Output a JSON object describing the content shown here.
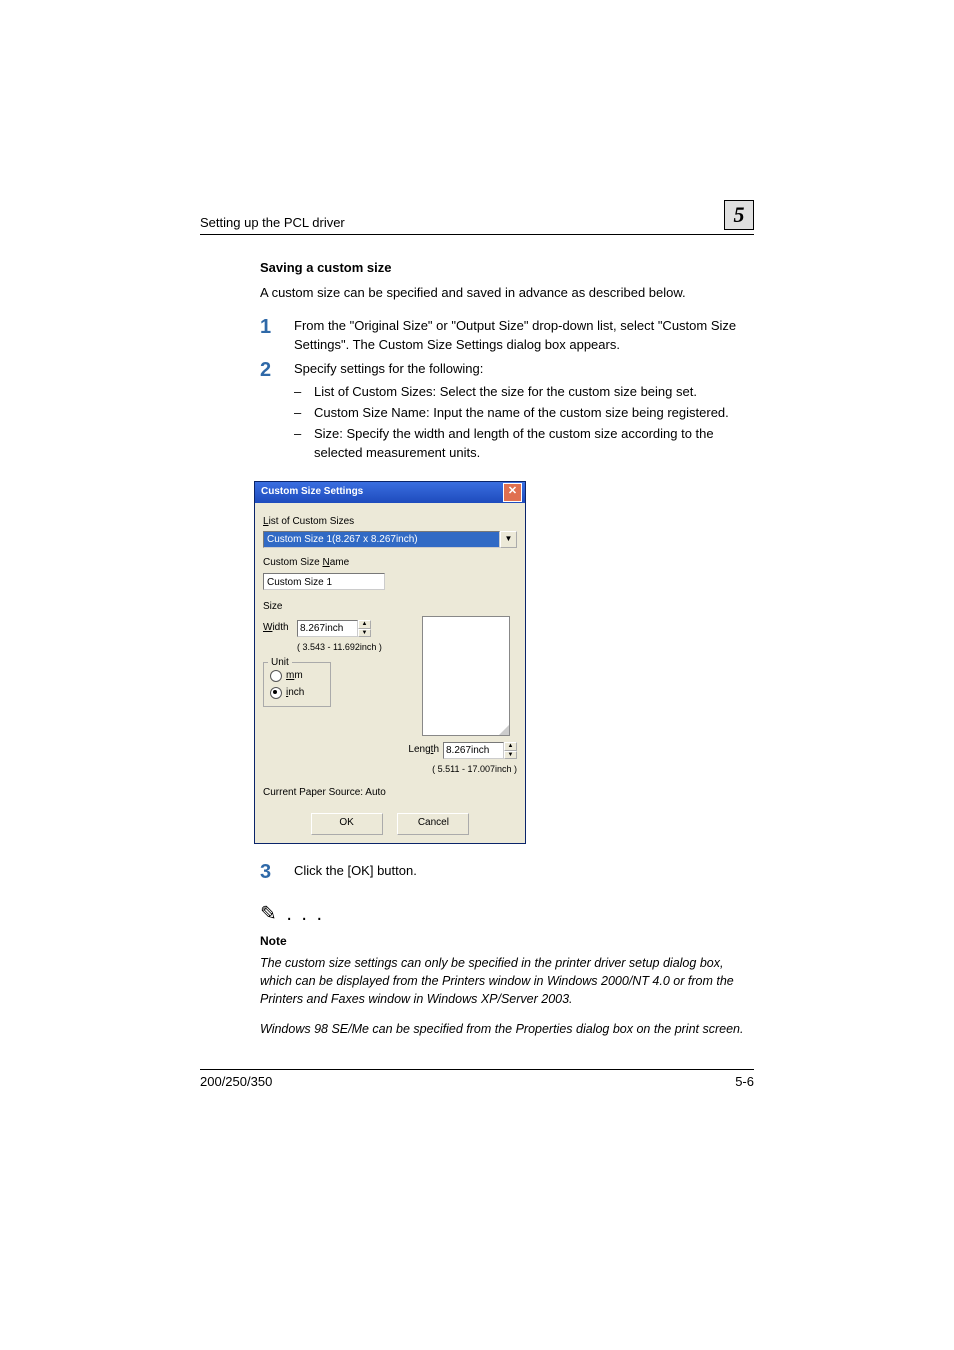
{
  "header": {
    "title": "Setting up the PCL driver",
    "chapter": "5"
  },
  "intro": {
    "heading": "Saving a custom size",
    "text": "A custom size can be specified and saved in advance as described below."
  },
  "steps": [
    {
      "num": "1",
      "text": "From the \"Original Size\" or \"Output Size\" drop-down list, select \"Custom Size Settings\". The Custom Size Settings dialog box appears."
    },
    {
      "num": "2",
      "text": "Specify settings for the following:",
      "bullets": [
        "List of Custom Sizes: Select the size for the custom size being set.",
        "Custom Size Name: Input the name of the custom size being registered.",
        "Size: Specify the width and length of the custom size according to the selected measurement units."
      ]
    },
    {
      "num": "3",
      "text": "Click the [OK] button."
    }
  ],
  "dialog": {
    "title": "Custom Size Settings",
    "list_label": "List of Custom Sizes",
    "list_value": "Custom Size 1(8.267 x 8.267inch)",
    "name_label": "Custom Size Name",
    "name_value": "Custom Size 1",
    "size_label": "Size",
    "width_label": "Width",
    "width_value": "8.267inch",
    "width_range": "( 3.543 - 11.692inch )",
    "unit_label": "Unit",
    "unit_mm": "mm",
    "unit_inch": "inch",
    "length_label": "Length",
    "length_value": "8.267inch",
    "length_range": "( 5.511 - 17.007inch )",
    "paper_source": "Current Paper Source: Auto",
    "ok": "OK",
    "cancel": "Cancel"
  },
  "note": {
    "icon": "✎ . . .",
    "title": "Note",
    "p1": "The custom size settings can only be specified in the printer driver setup dialog box, which can be displayed from the Printers window in Windows 2000/NT 4.0 or from the Printers and Faxes window in Windows XP/Server 2003.",
    "p2": "Windows 98 SE/Me can be specified from the Properties dialog box on the print screen."
  },
  "footer": {
    "left": "200/250/350",
    "right": "5-6"
  }
}
